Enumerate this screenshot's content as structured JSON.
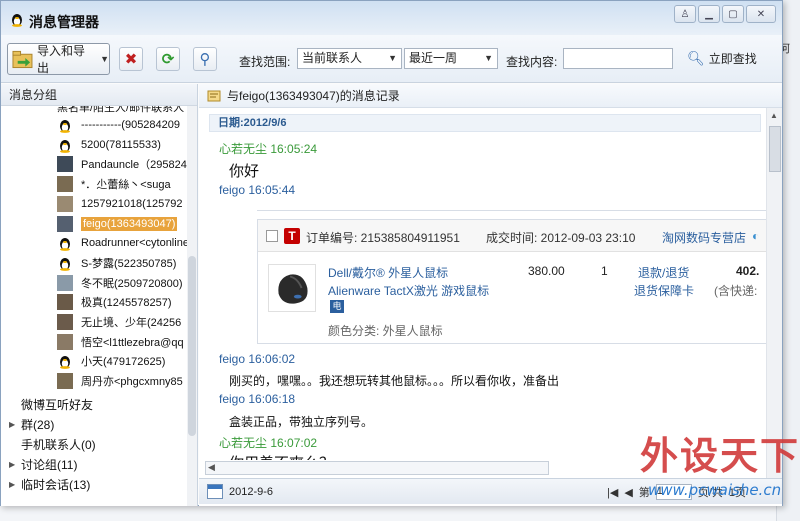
{
  "window": {
    "title": "消息管理器"
  },
  "background_labels": [
    "首",
    "何"
  ],
  "toolbar": {
    "import_export_label": "导入和导出",
    "scope_label": "查找范围:",
    "scope_value": "当前联系人",
    "time_value": "最近一周",
    "content_label": "查找内容:",
    "search_input_value": "",
    "search_now_label": "立即查找"
  },
  "sidebar": {
    "header": "消息分组",
    "cut_top_label": "黑名单/陌生人/邮件联系人",
    "contacts": [
      {
        "name": "-----------(905284209",
        "avatar": "qq-penguin"
      },
      {
        "name": "5200(78115533)",
        "avatar": "qq-penguin"
      },
      {
        "name": "Pandauncle（295824",
        "avatar": "photo"
      },
      {
        "name": "*．尐蕾絲丶<suga",
        "avatar": "photo"
      },
      {
        "name": "1257921018(125792",
        "avatar": "photo"
      },
      {
        "name": "feigo(1363493047)",
        "avatar": "photo"
      },
      {
        "name": "Roadrunner<cytonline",
        "avatar": "qq-penguin"
      },
      {
        "name": "S-梦露(522350785)",
        "avatar": "qq-penguin"
      },
      {
        "name": "冬不眠(2509720800)",
        "avatar": "photo"
      },
      {
        "name": "极真(1245578257)",
        "avatar": "photo"
      },
      {
        "name": "无止境、少年(24256",
        "avatar": "photo"
      },
      {
        "name": "悟空<l1ttlezebra@qq",
        "avatar": "photo"
      },
      {
        "name": "小天(479172625)",
        "avatar": "qq-penguin"
      },
      {
        "name": "周丹亦<phgcxmny85",
        "avatar": "photo"
      }
    ],
    "selected_contact": "feigo(1363493047)",
    "groups": [
      {
        "label": "微博互听好友",
        "expandable": false
      },
      {
        "label": "群(28)",
        "expandable": true
      },
      {
        "label": "手机联系人(0)",
        "expandable": false
      },
      {
        "label": "讨论组(11)",
        "expandable": true
      },
      {
        "label": "临时会话(13)",
        "expandable": true
      }
    ]
  },
  "chat": {
    "header": "与feigo(1363493047)的消息记录",
    "date_bar": "日期:2012/9/6",
    "messages": [
      {
        "sender": "心若无尘 16:05:24",
        "text": "你好",
        "self": true
      },
      {
        "sender": "feigo 16:05:44",
        "text": "",
        "self": false
      },
      {
        "sender": "feigo 16:06:02",
        "text": "刚买的，嘿嘿。。我还想玩转其他鼠标。。。所以看你收，准备出",
        "self": false
      },
      {
        "sender": "feigo 16:06:18",
        "text": "盒装正品，带独立序列号。",
        "self": false
      },
      {
        "sender": "心若无尘 16:07:02",
        "text": "你用着不爽么？",
        "self": true
      }
    ],
    "order": {
      "number_label": "订单编号: 215385804911951",
      "time_label": "成交时间: 2012-09-03 23:10",
      "shop": "淘网数码专营店",
      "product_name": "Dell/戴尔® 外星人鼠标",
      "product_sub": "Alienware TactX激光 游戏鼠标",
      "color": "颜色分类: 外星人鼠标",
      "price": "380.00",
      "qty": "1",
      "refund": "退款/退货",
      "guarantee": "退货保障卡",
      "total": "402.",
      "shipping": "(含快递:"
    },
    "footer_date": "2012-9-6",
    "pager": {
      "page_prefix": "第",
      "page_value": "1",
      "page_suffix": "页/共",
      "page_total": "1页"
    }
  },
  "watermark": {
    "big": "外设天下",
    "small": "www.pcwaishe.cn"
  },
  "colors": {
    "accent": "#e8a33c",
    "link": "#2b5f9e",
    "self_sender": "#3a9a3a"
  }
}
